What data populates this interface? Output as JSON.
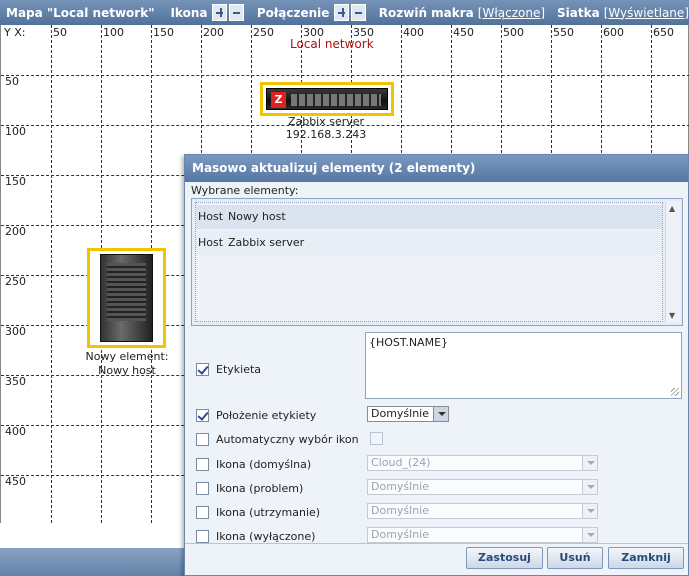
{
  "toolbar": {
    "map_label": "Mapa \"Local network\"",
    "icon_label": "Ikona",
    "connection_label": "Połączenie",
    "expand_macros_label": "Rozwiń makra",
    "expand_macros_value": "Włączone",
    "grid_label": "Siatka",
    "grid_value": "Wyświetlane"
  },
  "map": {
    "title": "Local network",
    "corner_label": "Y X:",
    "x_ticks": [
      "50",
      "100",
      "150",
      "200",
      "250",
      "300",
      "350",
      "400",
      "450",
      "500",
      "550",
      "600",
      "650"
    ],
    "y_ticks": [
      "50",
      "100",
      "150",
      "200",
      "250",
      "300",
      "350",
      "400",
      "450"
    ],
    "elements": [
      {
        "name": "Zabbix server",
        "label_line1": "Zabbix server",
        "label_line2": "192.168.3.243"
      },
      {
        "name": "Nowy host",
        "label_line1": "Nowy element:",
        "label_line2": "Nowy host"
      }
    ]
  },
  "dialog": {
    "title": "Masowo aktualizuj elementy  (2 elementy)",
    "selected_label": "Wybrane elementy:",
    "selected": [
      {
        "type": "Host",
        "name": "Nowy host"
      },
      {
        "type": "Host",
        "name": "Zabbix server"
      }
    ],
    "fields": {
      "label": {
        "name": "Etykieta",
        "checked": true,
        "value": "{HOST.NAME}"
      },
      "label_position": {
        "name": "Położenie etykiety",
        "checked": true,
        "value": "Domyślnie"
      },
      "auto_icon": {
        "name": "Automatyczny wybór ikon",
        "checked": false
      },
      "icon_default": {
        "name": "Ikona (domyślna)",
        "checked": false,
        "value": "Cloud_(24)"
      },
      "icon_problem": {
        "name": "Ikona (problem)",
        "checked": false,
        "value": "Domyślnie"
      },
      "icon_maintenance": {
        "name": "Ikona (utrzymanie)",
        "checked": false,
        "value": "Domyślnie"
      },
      "icon_disabled": {
        "name": "Ikona (wyłączone)",
        "checked": false,
        "value": "Domyślnie"
      }
    },
    "buttons": {
      "apply": "Zastosuj",
      "remove": "Usuń",
      "close": "Zamknij"
    }
  },
  "colors": {
    "toolbar": "#5f7fa8",
    "highlight": "#f2c400",
    "map_title": "#aa1111"
  }
}
